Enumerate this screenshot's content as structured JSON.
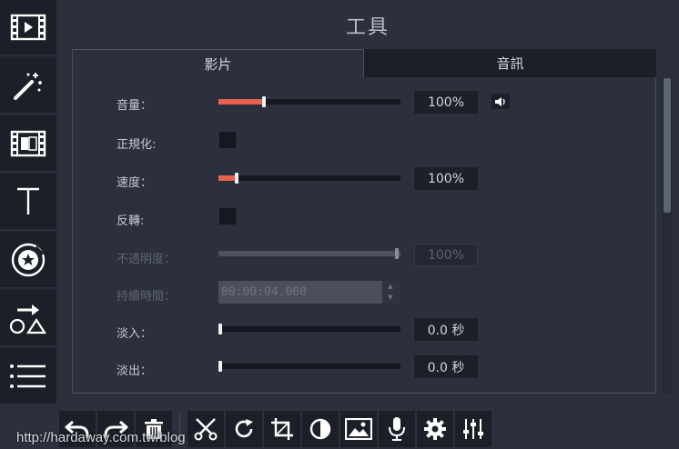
{
  "panel": {
    "title": "工具"
  },
  "tabs": [
    {
      "label": "影片",
      "active": true
    },
    {
      "label": "音訊",
      "active": false
    }
  ],
  "rows": {
    "volume": {
      "label": "音量：",
      "percent": 25,
      "value": "100%"
    },
    "normalize": {
      "label": "正規化:"
    },
    "speed": {
      "label": "速度：",
      "percent": 10,
      "value": "100%"
    },
    "reverse": {
      "label": "反轉:"
    },
    "opacity": {
      "label": "不透明度：",
      "percent": 98,
      "value": "100%"
    },
    "duration": {
      "label": "持續時間：",
      "value": "00:00:04.000"
    },
    "fade_in": {
      "label": "淡入：",
      "percent": 1,
      "value": "0.0 秒"
    },
    "fade_out": {
      "label": "淡出：",
      "percent": 1,
      "value": "0.0 秒"
    }
  },
  "sidebar_icons": [
    "clips-icon",
    "magic-wand-icon",
    "filter-strip-icon",
    "text-icon",
    "sticker-icon",
    "shapes-icon",
    "list-icon"
  ],
  "toolbar_icons": [
    "undo-icon",
    "redo-icon",
    "trash-icon",
    "scissors-icon",
    "rotate-icon",
    "crop-icon",
    "color-adjust-icon",
    "image-icon",
    "microphone-icon",
    "gear-icon",
    "equalizer-icon"
  ],
  "colors": {
    "accent": "#e5624d",
    "background": "#2b303c",
    "sidebar": "#1b1f27"
  },
  "watermark": "http://hardaway.com.tw/blog"
}
